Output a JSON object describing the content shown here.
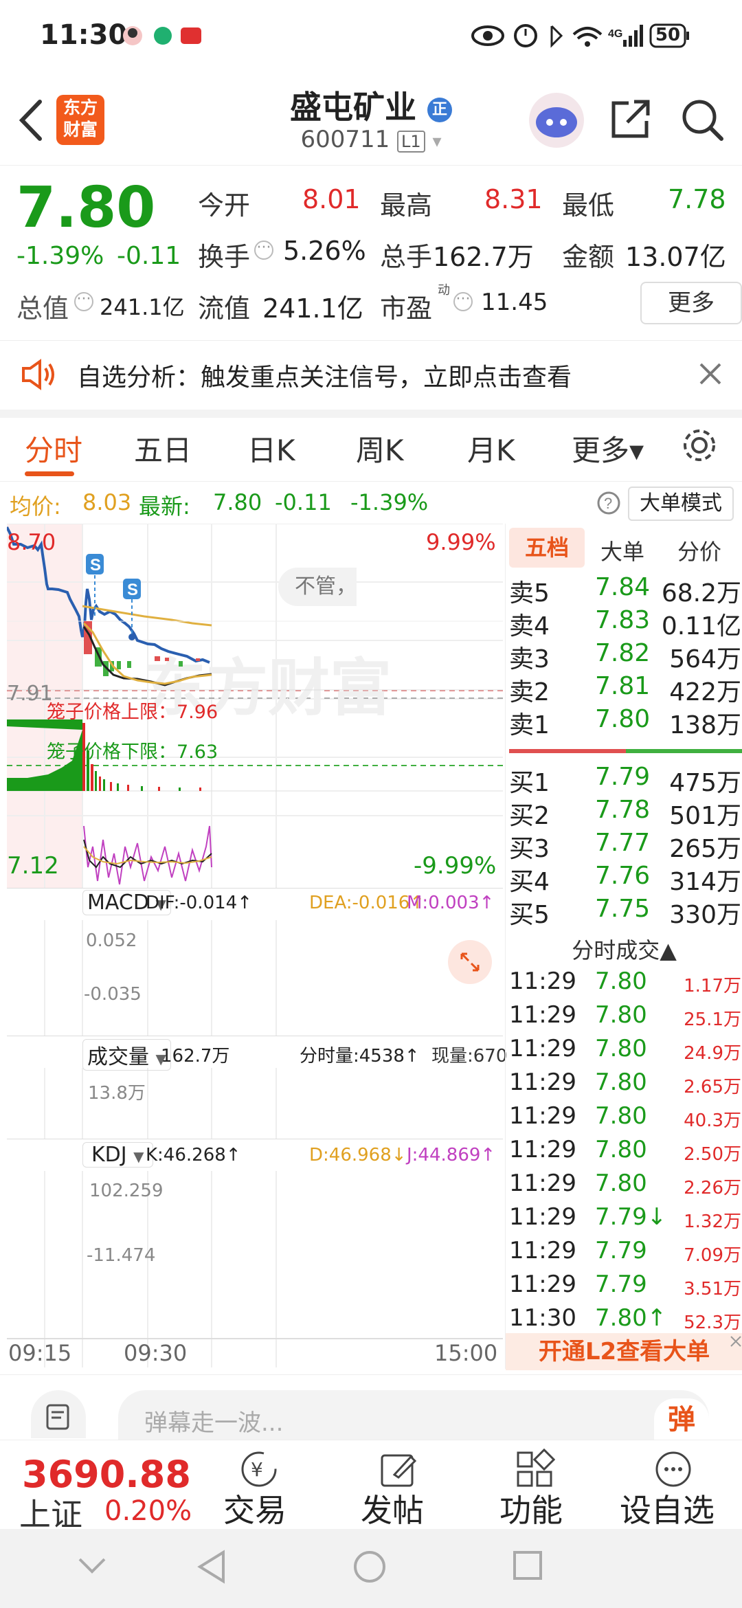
{
  "status_bar": {
    "time": "11:30",
    "battery": "50",
    "network": "4G"
  },
  "header": {
    "stock_name": "盛屯矿业",
    "stock_code": "600711",
    "level_badge": "L1",
    "logo_text": [
      "东方",
      "财富"
    ],
    "name_badge": "正"
  },
  "quote": {
    "price": "7.80",
    "change_pct": "-1.39%",
    "change": "-0.11",
    "open_label": "今开",
    "open": "8.01",
    "high_label": "最高",
    "high": "8.31",
    "low_label": "最低",
    "low": "7.78",
    "turnover_label": "换手",
    "turnover": "5.26%",
    "volume_label": "总手",
    "volume": "162.7万",
    "amount_label": "金额",
    "amount": "13.07亿",
    "mktcap_label": "总值",
    "mktcap": "241.1亿",
    "float_label": "流值",
    "float_cap": "241.1亿",
    "pe_label": "市盈",
    "pe_sup": "动",
    "pe": "11.45",
    "more_button": "更多"
  },
  "alert": {
    "text": "自选分析：触发重点关注信号，立即点击查看"
  },
  "tabs": [
    "分时",
    "五日",
    "日K",
    "周K",
    "月K",
    "更多▾"
  ],
  "info_line": {
    "avg_label": "均价:",
    "avg": "8.03",
    "latest_label": "最新:",
    "latest": "7.80",
    "chg": "-0.11",
    "chg_pct": "-1.39%",
    "mode_button": "大单模式"
  },
  "chart": {
    "price_high": "8.70",
    "price_low": "7.12",
    "price_mid": "7.91",
    "pct_high": "9.99%",
    "pct_low": "-9.99%",
    "cage_upper": "笼子价格上限：7.96",
    "cage_lower": "笼子价格下限：7.63",
    "popup_text": "不管，",
    "signal_label": "S",
    "watermark": "东方财富",
    "macd": {
      "name": "MACD",
      "dif": "DIF:-0.014↑",
      "dea": "DEA:-0.016↑",
      "m": "M:0.003↑",
      "top": "0.052",
      "bottom": "-0.035"
    },
    "volume": {
      "name": "成交量",
      "total": "162.7万",
      "minute": "分时量:4538↑",
      "current": "现量:670",
      "top": "13.8万"
    },
    "kdj": {
      "name": "KDJ",
      "k": "K:46.268↑",
      "d": "D:46.968↓",
      "j": "J:44.869↑",
      "top": "102.259",
      "bottom": "-11.474"
    },
    "times": [
      "09:15",
      "09:30",
      "15:00"
    ],
    "colors": {
      "up": "#e02a2a",
      "down": "#1a9a1a",
      "price_line": "#2a5fb0",
      "avg_line": "#e0b040"
    }
  },
  "orderbook": {
    "tabs": [
      "五档",
      "大单",
      "分价"
    ],
    "asks": [
      {
        "label": "卖5",
        "price": "7.84",
        "vol": "68.2万"
      },
      {
        "label": "卖4",
        "price": "7.83",
        "vol": "0.11亿"
      },
      {
        "label": "卖3",
        "price": "7.82",
        "vol": "564万"
      },
      {
        "label": "卖2",
        "price": "7.81",
        "vol": "422万"
      },
      {
        "label": "卖1",
        "price": "7.80",
        "vol": "138万"
      }
    ],
    "bids": [
      {
        "label": "买1",
        "price": "7.79",
        "vol": "475万"
      },
      {
        "label": "买2",
        "price": "7.78",
        "vol": "501万"
      },
      {
        "label": "买3",
        "price": "7.77",
        "vol": "265万"
      },
      {
        "label": "买4",
        "price": "7.76",
        "vol": "314万"
      },
      {
        "label": "买5",
        "price": "7.75",
        "vol": "330万"
      }
    ],
    "ticks_title": "分时成交▲",
    "ticks": [
      {
        "time": "11:29",
        "price": "7.80",
        "vol": "1.17万"
      },
      {
        "time": "11:29",
        "price": "7.80",
        "vol": "25.1万"
      },
      {
        "time": "11:29",
        "price": "7.80",
        "vol": "24.9万"
      },
      {
        "time": "11:29",
        "price": "7.80",
        "vol": "2.65万"
      },
      {
        "time": "11:29",
        "price": "7.80",
        "vol": "40.3万"
      },
      {
        "time": "11:29",
        "price": "7.80",
        "vol": "2.50万"
      },
      {
        "time": "11:29",
        "price": "7.80",
        "vol": "2.26万"
      },
      {
        "time": "11:29",
        "price": "7.79↓",
        "vol": "1.32万"
      },
      {
        "time": "11:29",
        "price": "7.79",
        "vol": "7.09万"
      },
      {
        "time": "11:29",
        "price": "7.79",
        "vol": "3.51万"
      },
      {
        "time": "11:30",
        "price": "7.80↑",
        "vol": "52.3万"
      }
    ],
    "l2_banner": "开通L2查看大单"
  },
  "danmu": {
    "placeholder": "弹幕走一波...",
    "button": "弹"
  },
  "bottom_bar": {
    "index_value": "3690.88",
    "index_name": "上证",
    "index_pct": "0.20%",
    "items": [
      "交易",
      "发帖",
      "功能",
      "设自选"
    ]
  }
}
